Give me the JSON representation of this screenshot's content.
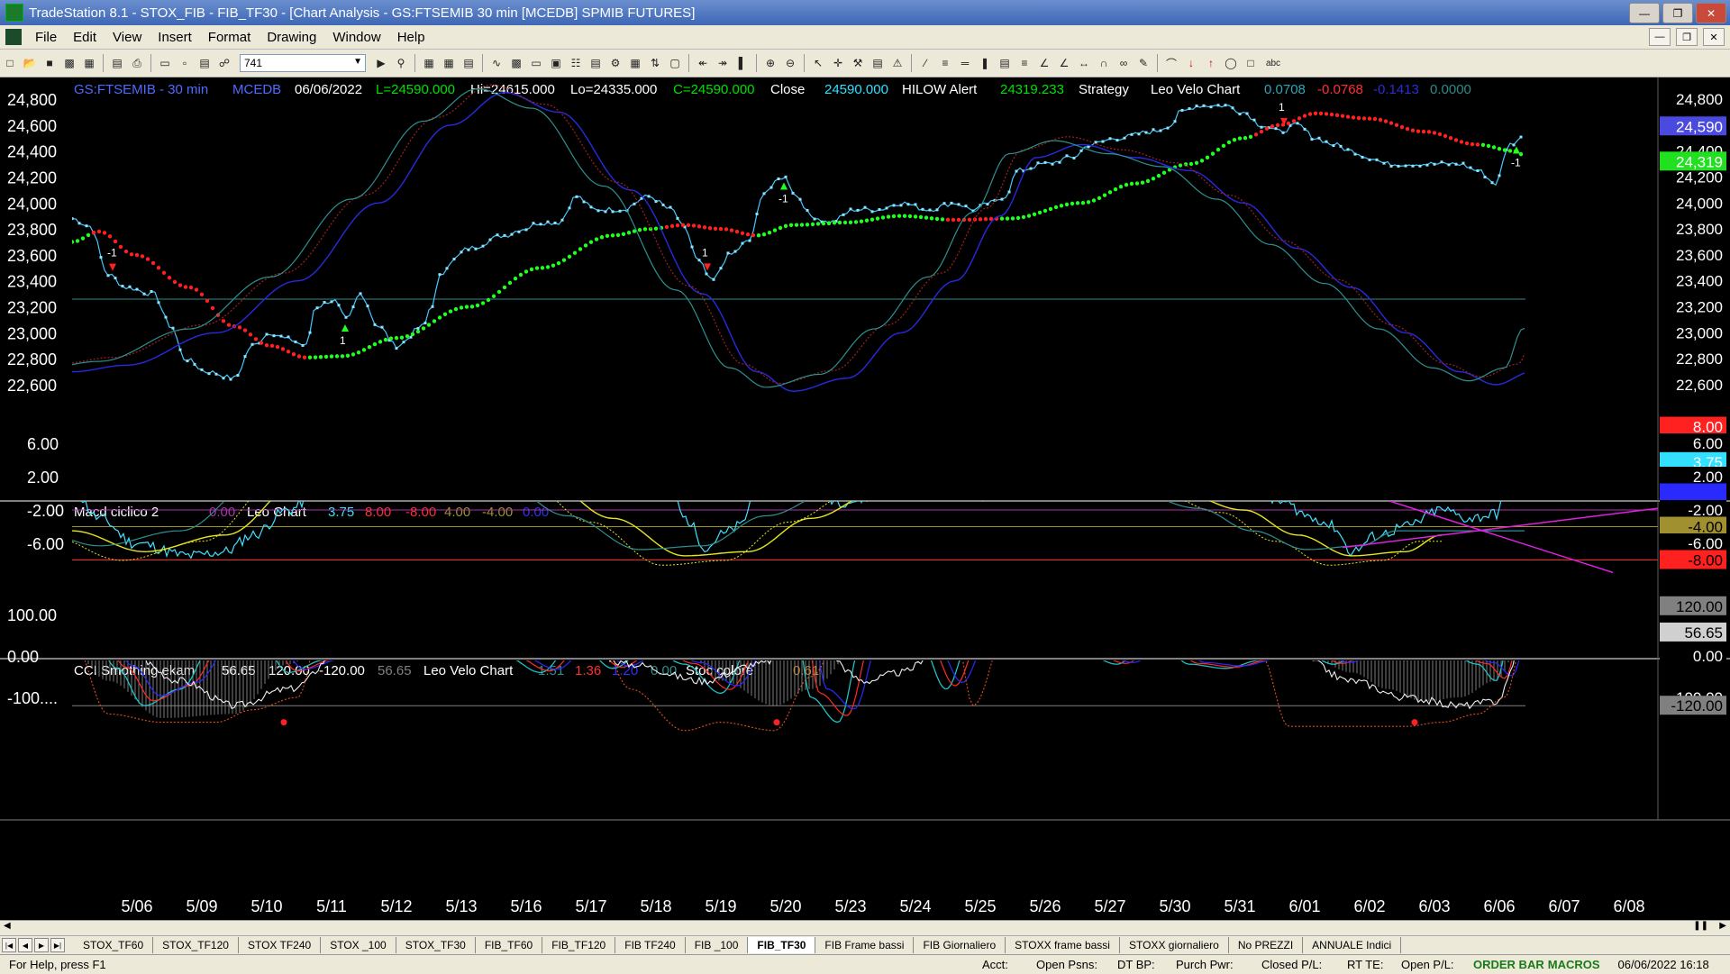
{
  "window": {
    "title": "TradeStation 8.1 - STOX_FIB - FIB_TF30 - [Chart Analysis - GS:FTSEMIB  30 min  [MCEDB] SPMIB FUTURES]"
  },
  "menu": [
    "File",
    "Edit",
    "View",
    "Insert",
    "Format",
    "Drawing",
    "Window",
    "Help"
  ],
  "toolbar": {
    "symbol_value": "741"
  },
  "header": {
    "symbol": "GS:FTSEMIB - 30 min",
    "feed": "MCEDB",
    "date": "06/06/2022",
    "last": "L=24590.000",
    "hi": "Hi=24615.000",
    "lo": "Lo=24335.000",
    "close_val": "C=24590.000",
    "close_lbl": "Close",
    "close_num": "24590.000",
    "hilow": "HILOW Alert",
    "hilow_val": "24319.233",
    "strategy": "Strategy",
    "leo_velo": "Leo Velo Chart",
    "v1": "0.0708",
    "v2": "-0.0768",
    "v3": "-0.1413",
    "v4": "0.0000"
  },
  "panel2": {
    "name": "Macd ciclico 2",
    "v0": "0.00",
    "leo": "Leo Chart",
    "a": "3.75",
    "b": "8.00",
    "c": "-8.00",
    "d": "4.00",
    "e": "-4.00",
    "f": "0.00"
  },
  "panel3": {
    "name": "CCI Smothing ekam",
    "a": "56.65",
    "b": "120.00",
    "c": "-120.00",
    "d": "56.65",
    "leo": "Leo Velo Chart",
    "e": "1.51",
    "f": "1.36",
    "g": "1.20",
    "h": "0.00",
    "stoc": "Stoc colore",
    "i": "0.61"
  },
  "price_axis": [
    "24,800",
    "24,600",
    "24,400",
    "24,200",
    "24,000",
    "23,800",
    "23,600",
    "23,400",
    "23,200",
    "23,000",
    "22,800",
    "22,600"
  ],
  "price_badges": {
    "close": "24,590",
    "hilow": "24,319"
  },
  "macd_axis": [
    "6.00",
    "2.00",
    "-2.00",
    "-6.00"
  ],
  "macd_badges": [
    "8.00",
    "6.00",
    "3.75",
    "2.00",
    "0.00",
    "-2.00",
    "-4.00",
    "-6.00",
    "-8.00"
  ],
  "cci_axis": [
    "100.00",
    "0.00",
    "-100...."
  ],
  "cci_badges": [
    "120.00",
    "56.65",
    "0.00",
    "-100.00",
    "-120.00"
  ],
  "dates": [
    "5/06",
    "5/09",
    "5/10",
    "5/11",
    "5/12",
    "5/13",
    "5/16",
    "5/17",
    "5/18",
    "5/19",
    "5/20",
    "5/23",
    "5/24",
    "5/25",
    "5/26",
    "5/27",
    "5/30",
    "5/31",
    "6/01",
    "6/02",
    "6/03",
    "6/06",
    "6/07",
    "6/08"
  ],
  "tabs": [
    "STOX_TF60",
    "STOX_TF120",
    "STOX TF240",
    "STOX _100",
    "STOX_TF30",
    "FIB_TF60",
    "FIB_TF120",
    "FIB TF240",
    "FIB _100",
    "FIB_TF30",
    "FIB Frame bassi",
    "FIB Giornaliero",
    "STOXX frame bassi",
    "STOXX giornaliero",
    "No PREZZI",
    "ANNUALE Indici"
  ],
  "active_tab": "FIB_TF30",
  "status": {
    "help": "For Help, press F1",
    "acct": "Acct:",
    "psns": "Open Psns:",
    "dtbp": "DT BP:",
    "purch": "Purch Pwr:",
    "closed": "Closed P/L:",
    "rtte": "RT TE:",
    "openpl": "Open P/L:",
    "orderbar": "ORDER BAR",
    "macros": "MACROS",
    "datetime": "06/06/2022 16:18"
  },
  "signals": [
    "-1",
    "1",
    "1",
    "-1",
    "1",
    "-1",
    "1"
  ]
}
